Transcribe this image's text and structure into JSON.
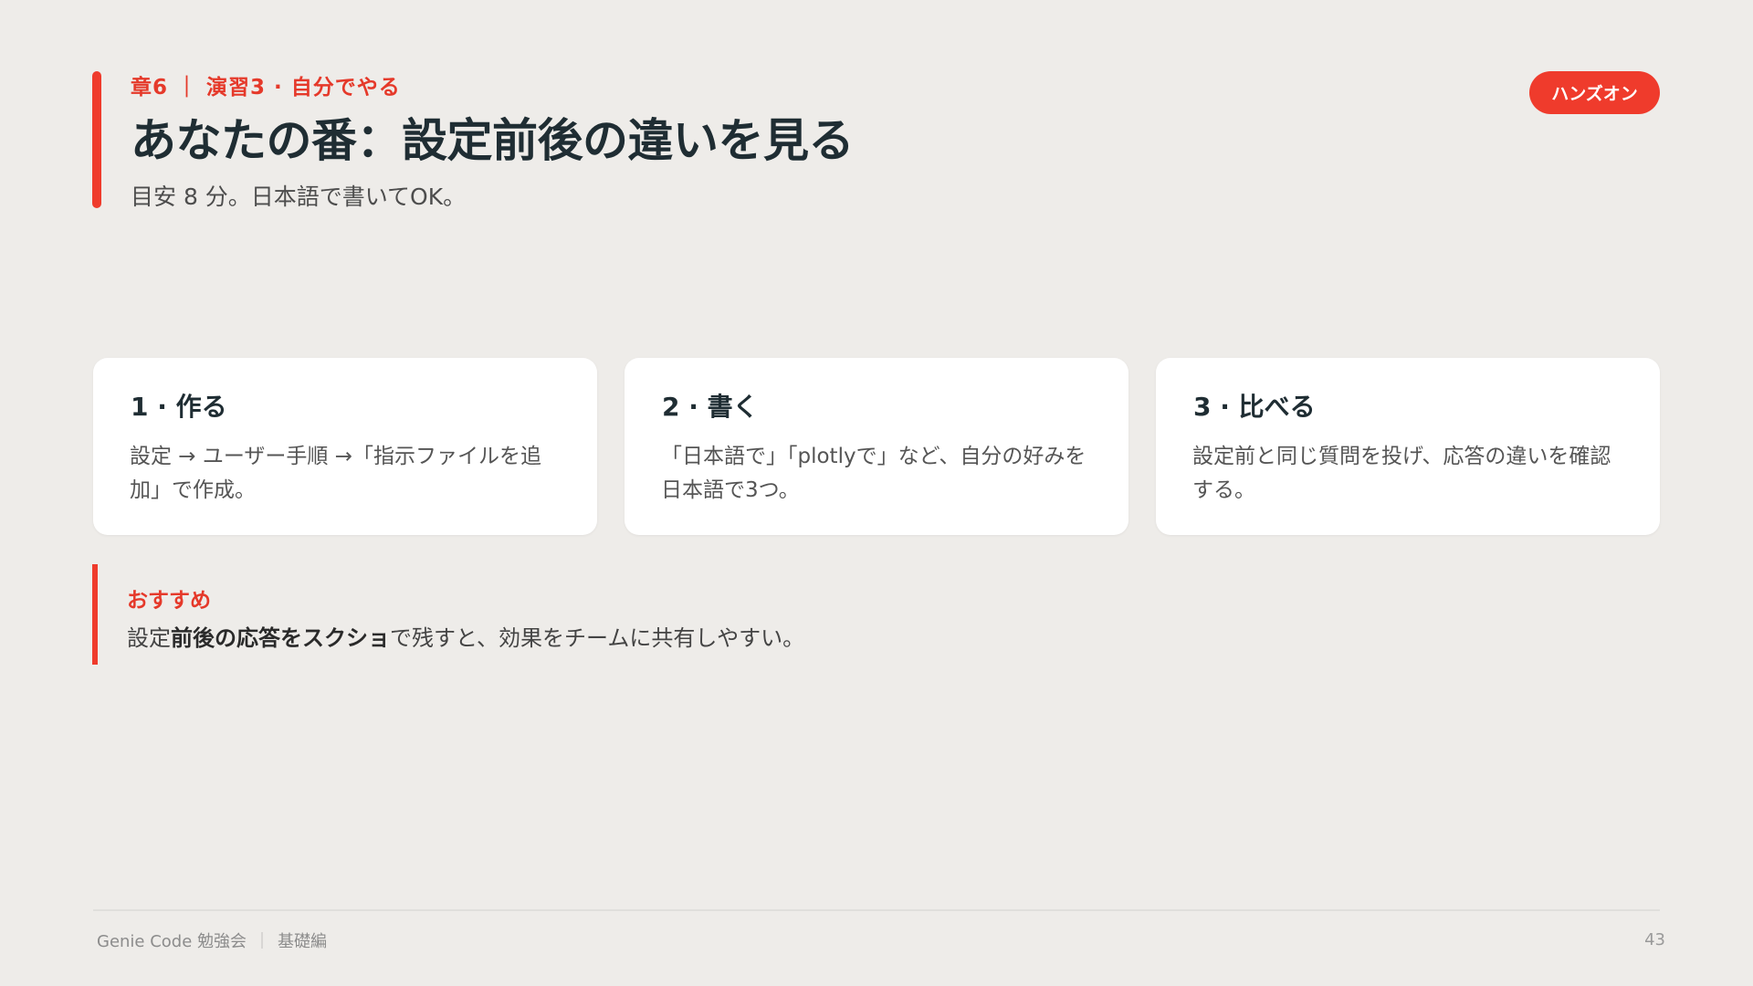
{
  "header": {
    "eyebrow": "章6 ｜ 演習3 · 自分でやる",
    "title": "あなたの番：設定前後の違いを見る",
    "subtitle": "目安 8 分。日本語で書いてOK。",
    "badge": "ハンズオン"
  },
  "steps": [
    {
      "title": "1 · 作る",
      "body": "設定 → ユーザー手順 →「指示ファイルを追加」で作成。"
    },
    {
      "title": "2 · 書く",
      "body": "「日本語で」「plotlyで」など、自分の好みを日本語で3つ。"
    },
    {
      "title": "3 · 比べる",
      "body": "設定前と同じ質問を投げ、応答の違いを確認する。"
    }
  ],
  "tip": {
    "label": "おすすめ",
    "text_prefix": "設定",
    "text_bold": "前後の応答をスクショ",
    "text_suffix": "で残すと、効果をチームに共有しやすい。"
  },
  "footer": {
    "title": "Genie Code 勉強会",
    "separator": "｜",
    "section": "基礎編",
    "page": "43"
  },
  "colors": {
    "accent": "#ef3b2c",
    "background": "#eeece9",
    "card": "#ffffff",
    "heading": "#1f2d33"
  }
}
